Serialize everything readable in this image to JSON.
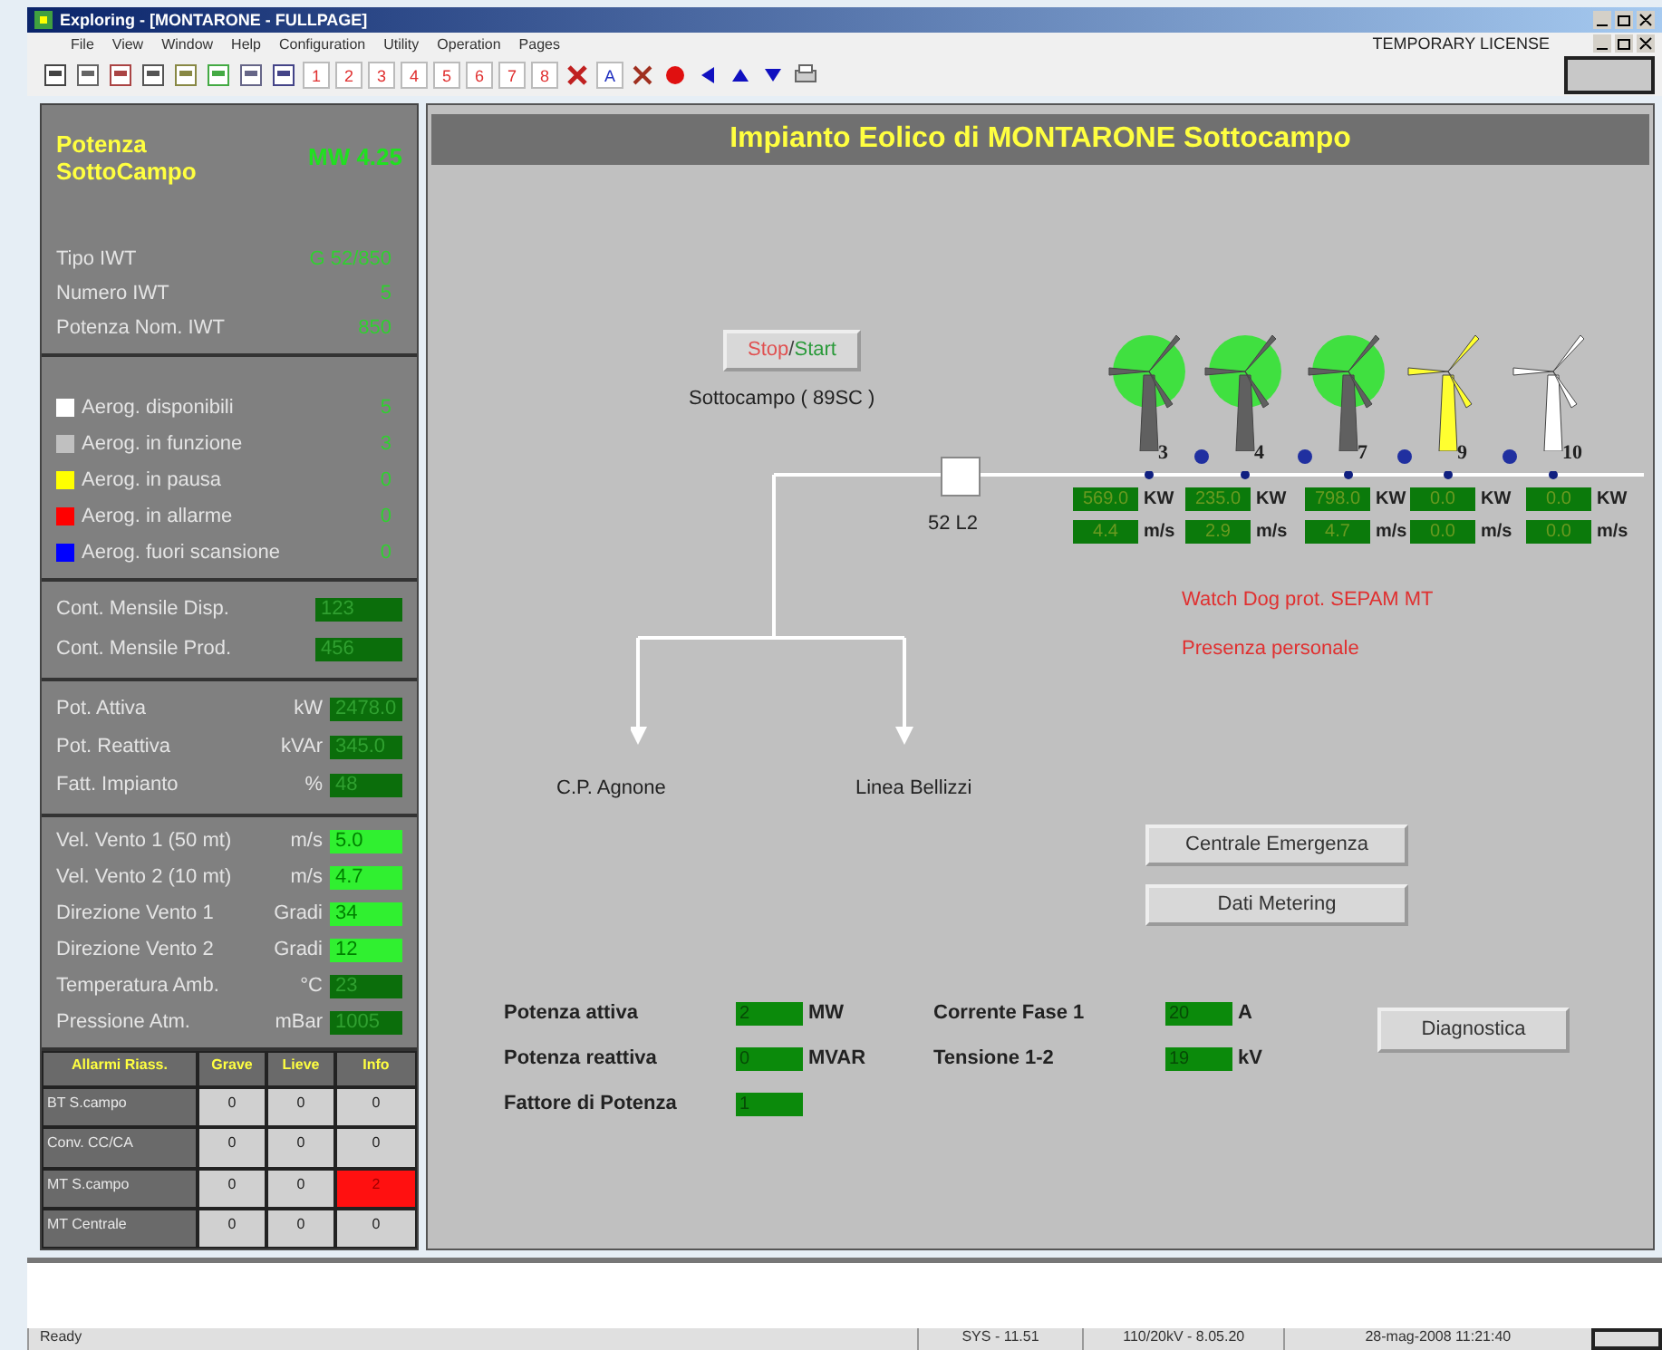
{
  "window": {
    "title": "Exploring - [MONTARONE - FULLPAGE]"
  },
  "menu": [
    "File",
    "View",
    "Window",
    "Help",
    "Configuration",
    "Utility",
    "Operation",
    "Pages"
  ],
  "license": "TEMPORARY LICENSE",
  "toolbar": {
    "page_buttons": [
      "1",
      "2",
      "3",
      "4",
      "5",
      "6",
      "7",
      "8"
    ],
    "font_button": "A"
  },
  "summary": {
    "title": "Potenza SottoCampo",
    "value": "MW 4.25",
    "rows": [
      {
        "label": "Tipo IWT",
        "value": "G 52/850"
      },
      {
        "label": "Numero IWT",
        "value": "5"
      },
      {
        "label": "Potenza Nom. IWT",
        "value": "850"
      }
    ]
  },
  "legend": [
    {
      "label": "Aerog. disponibili",
      "value": "5",
      "color": "#ffffff"
    },
    {
      "label": "Aerog. in funzione",
      "value": "3",
      "color": "#c0c0c0"
    },
    {
      "label": "Aerog. in pausa",
      "value": "0",
      "color": "#ffff00"
    },
    {
      "label": "Aerog. in allarme",
      "value": "0",
      "color": "#ff0000"
    },
    {
      "label": "Aerog. fuori scansione",
      "value": "0",
      "color": "#0000ff"
    }
  ],
  "counters": [
    {
      "label": "Cont. Mensile Disp.",
      "value": "123",
      "highlight": false
    },
    {
      "label": "Cont. Mensile Prod.",
      "value": "456",
      "highlight": false
    }
  ],
  "power": [
    {
      "label": "Pot. Attiva",
      "unit": "kW",
      "value": "2478.0",
      "highlight": false
    },
    {
      "label": "Pot. Reattiva",
      "unit": "kVAr",
      "value": "345.0",
      "highlight": false
    },
    {
      "label": "Fatt. Impianto",
      "unit": "%",
      "value": "48",
      "highlight": false
    }
  ],
  "weather": [
    {
      "label": "Vel. Vento 1 (50 mt)",
      "unit": "m/s",
      "value": "5.0",
      "highlight": true
    },
    {
      "label": "Vel. Vento 2 (10 mt)",
      "unit": "m/s",
      "value": "4.7",
      "highlight": true
    },
    {
      "label": "Direzione Vento 1",
      "unit": "Gradi",
      "value": "34",
      "highlight": true
    },
    {
      "label": "Direzione Vento 2",
      "unit": "Gradi",
      "value": "12",
      "highlight": true
    },
    {
      "label": "Temperatura Amb.",
      "unit": "°C",
      "value": "23",
      "highlight": false
    },
    {
      "label": "Pressione Atm.",
      "unit": "mBar",
      "value": "1005",
      "highlight": false
    }
  ],
  "alarms": {
    "columns": [
      "Allarmi Riass.",
      "Grave",
      "Lieve",
      "Info"
    ],
    "rows": [
      {
        "cells": [
          {
            "value": "BT S.campo"
          },
          {
            "value": "0",
            "alarm": false
          },
          {
            "value": "0",
            "alarm": false
          },
          {
            "value": "0",
            "alarm": false
          }
        ]
      },
      {
        "cells": [
          {
            "value": "Conv. CC/CA"
          },
          {
            "value": "0",
            "alarm": false
          },
          {
            "value": "0",
            "alarm": false
          },
          {
            "value": "0",
            "alarm": false
          }
        ]
      },
      {
        "cells": [
          {
            "value": "MT S.campo"
          },
          {
            "value": "0",
            "alarm": false
          },
          {
            "value": "0",
            "alarm": false
          },
          {
            "value": "2",
            "alarm": true
          }
        ]
      },
      {
        "cells": [
          {
            "value": "MT Centrale"
          },
          {
            "value": "0",
            "alarm": false
          },
          {
            "value": "0",
            "alarm": false
          },
          {
            "value": "0",
            "alarm": false
          }
        ]
      }
    ]
  },
  "main": {
    "title": "Impianto Eolico di MONTARONE Sottocampo",
    "stop_start": [
      {
        "text": "Stop",
        "color": "#e05050"
      },
      {
        "text": "/",
        "color": "#404040"
      },
      {
        "text": "Start",
        "color": "#2a9a3a"
      }
    ],
    "section_label": "Sottocampo ( 89SC )",
    "breaker": {
      "label": "52 L2",
      "closed": true
    },
    "turbines": [
      {
        "number": "3",
        "kind": "running",
        "power": "569.0",
        "power_unit": "KW",
        "wind": "4.4",
        "wind_unit": "m/s"
      },
      {
        "number": "4",
        "kind": "running",
        "power": "235.0",
        "power_unit": "KW",
        "wind": "2.9",
        "wind_unit": "m/s"
      },
      {
        "number": "7",
        "kind": "running",
        "power": "798.0",
        "power_unit": "KW",
        "wind": "4.7",
        "wind_unit": "m/s"
      },
      {
        "number": "9",
        "kind": "paused",
        "power": "0.0",
        "power_unit": "KW",
        "wind": "0.0",
        "wind_unit": "m/s"
      },
      {
        "number": "10",
        "kind": "available",
        "power": "0.0",
        "power_unit": "KW",
        "wind": "0.0",
        "wind_unit": "m/s"
      }
    ],
    "messages": [
      "Watch Dog prot. SEPAM MT",
      "Presenza personale"
    ],
    "feeders": [
      "C.P. Agnone",
      "Linea Bellizzi"
    ],
    "buttons": [
      "Centrale Emergenza",
      "Dati Metering"
    ],
    "measures": [
      {
        "label": "Potenza attiva",
        "value": "2",
        "unit": "MW"
      },
      {
        "label": "Corrente Fase 1",
        "value": "20",
        "unit": "A"
      },
      {
        "label": "Potenza reattiva",
        "value": "0",
        "unit": "MVAR"
      },
      {
        "label": "Tensione 1-2",
        "value": "19",
        "unit": "kV"
      },
      {
        "label": "Fattore di Potenza",
        "value": "1"
      }
    ],
    "diagnostics_button": "Diagnostica"
  },
  "status_bar": [
    "Ready",
    "SYS - 11.51",
    "110/20kV - 8.05.20",
    "28-mag-2008 11:21:40"
  ]
}
